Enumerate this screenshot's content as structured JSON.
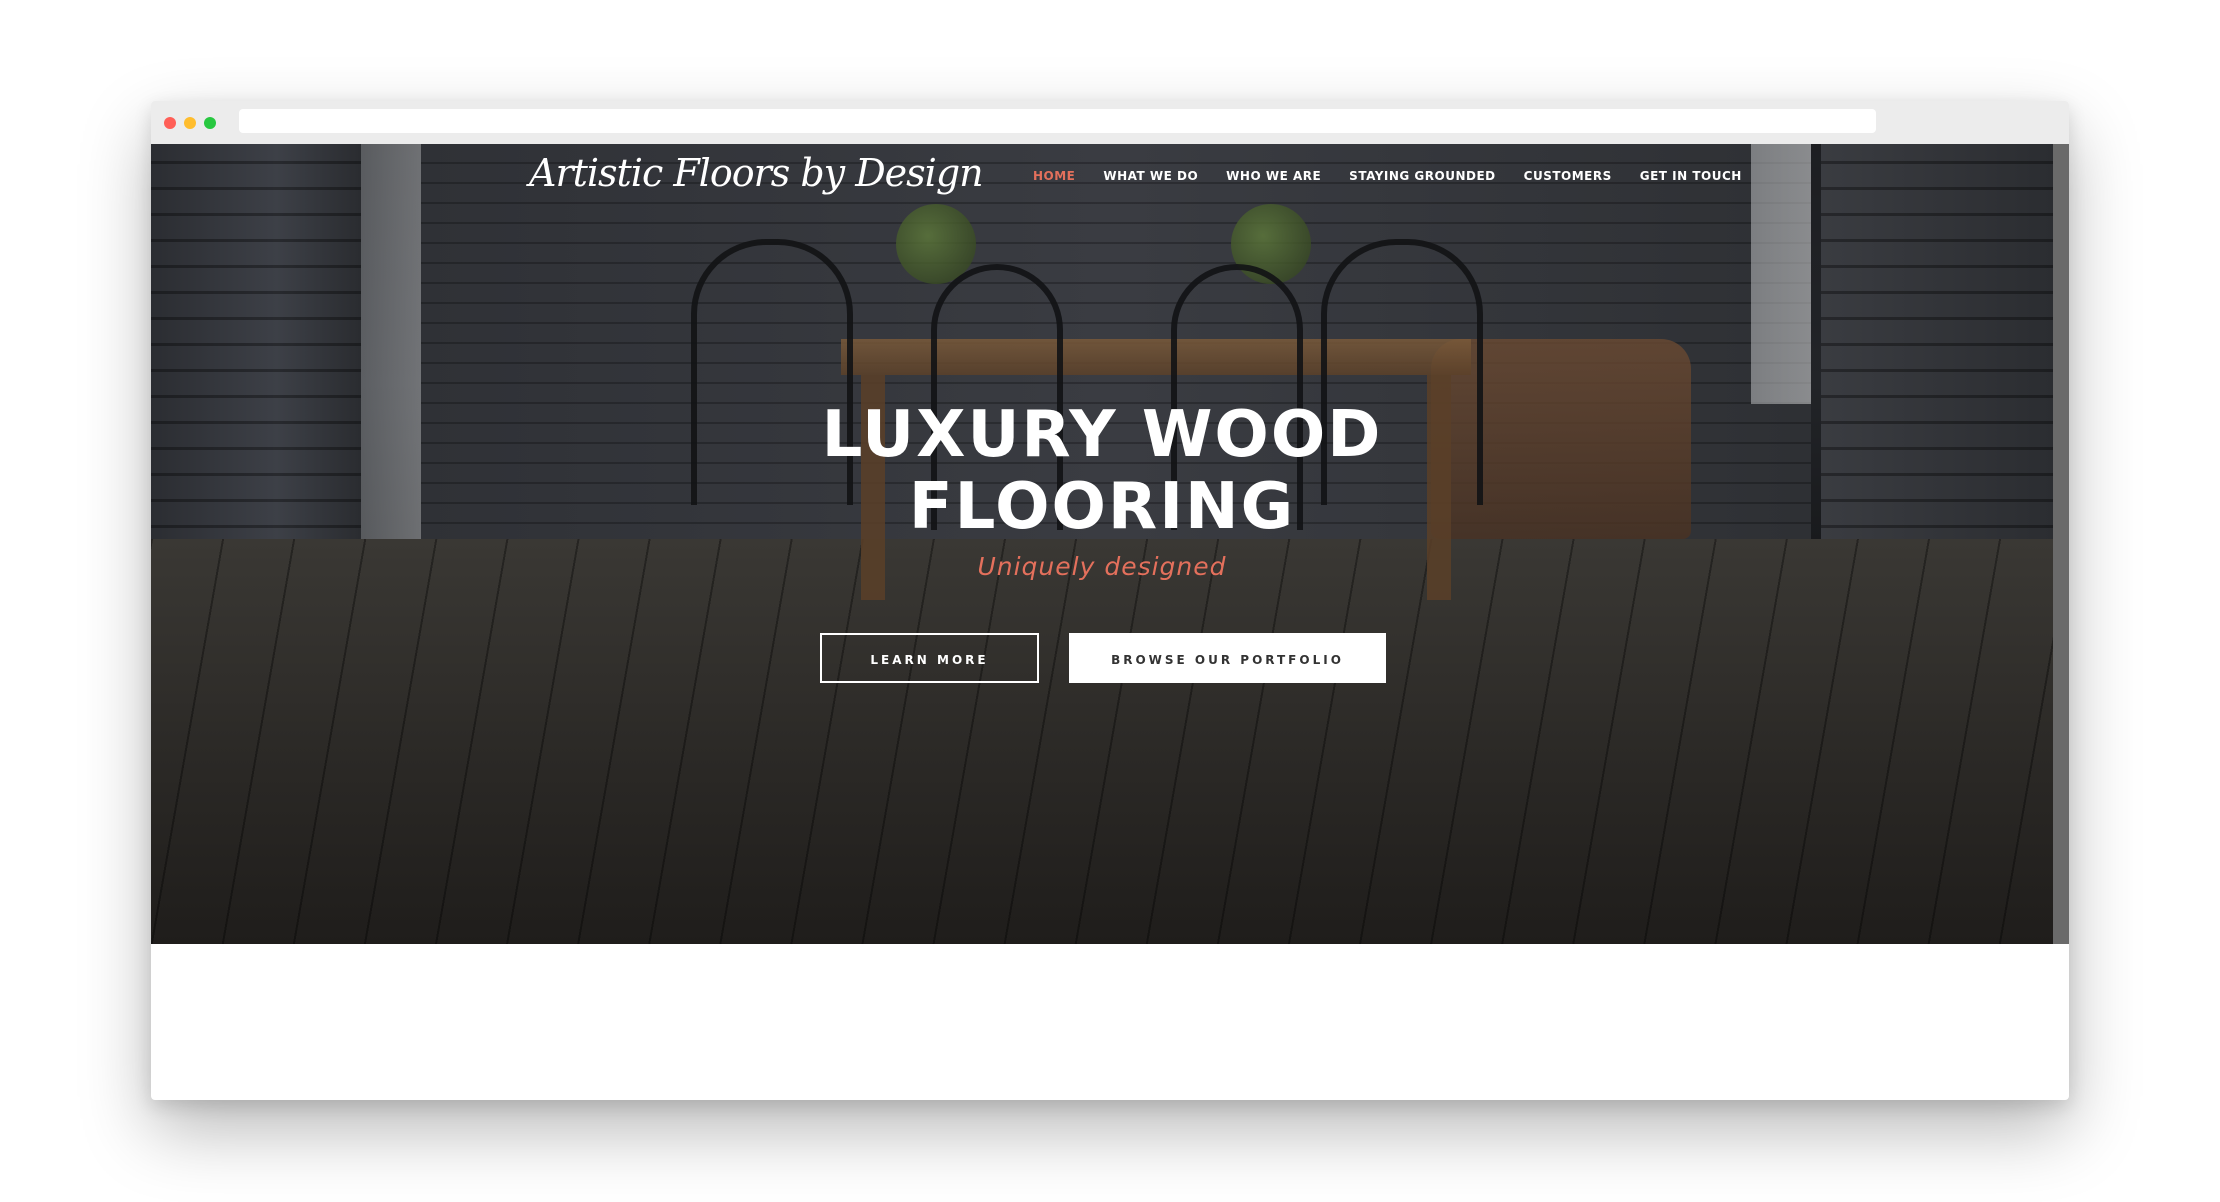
{
  "browser": {
    "url": ""
  },
  "site": {
    "logo_text": "Artistic Floors by Design"
  },
  "nav": {
    "items": [
      {
        "label": "HOME",
        "active": true
      },
      {
        "label": "WHAT WE DO",
        "active": false
      },
      {
        "label": "WHO WE ARE",
        "active": false
      },
      {
        "label": "STAYING GROUNDED",
        "active": false
      },
      {
        "label": "CUSTOMERS",
        "active": false
      },
      {
        "label": "GET IN TOUCH",
        "active": false
      }
    ]
  },
  "hero": {
    "headline_line1": "LUXURY WOOD",
    "headline_line2": "FLOORING",
    "subheadline": "Uniquely designed",
    "learn_more_label": "LEARN MORE",
    "portfolio_label": "BROWSE OUR PORTFOLIO"
  },
  "colors": {
    "accent": "#e4705c",
    "button_border": "#ffffff"
  }
}
